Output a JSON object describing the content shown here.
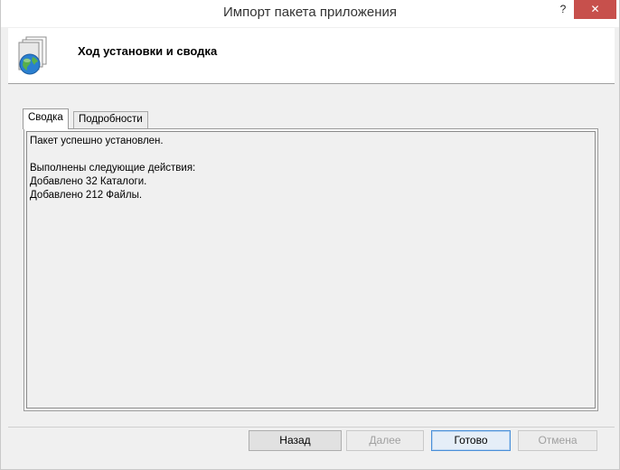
{
  "window": {
    "title": "Импорт пакета приложения"
  },
  "controls": {
    "help_label": "?",
    "close_label": "✕"
  },
  "header": {
    "title": "Ход установки и сводка",
    "icon": "package-globe-icon"
  },
  "tabs": [
    {
      "label": "Сводка",
      "selected": true
    },
    {
      "label": "Подробности",
      "selected": false
    }
  ],
  "summary": {
    "lines": [
      "Пакет успешно установлен.",
      "",
      "Выполнены следующие действия:",
      "Добавлено 32 Каталоги.",
      "Добавлено 212 Файлы."
    ]
  },
  "buttons": {
    "back": "Назад",
    "next": "Далее",
    "finish": "Готово",
    "cancel": "Отмена"
  },
  "colors": {
    "close_button": "#c7504c",
    "default_button_border": "#4a8fd9"
  }
}
